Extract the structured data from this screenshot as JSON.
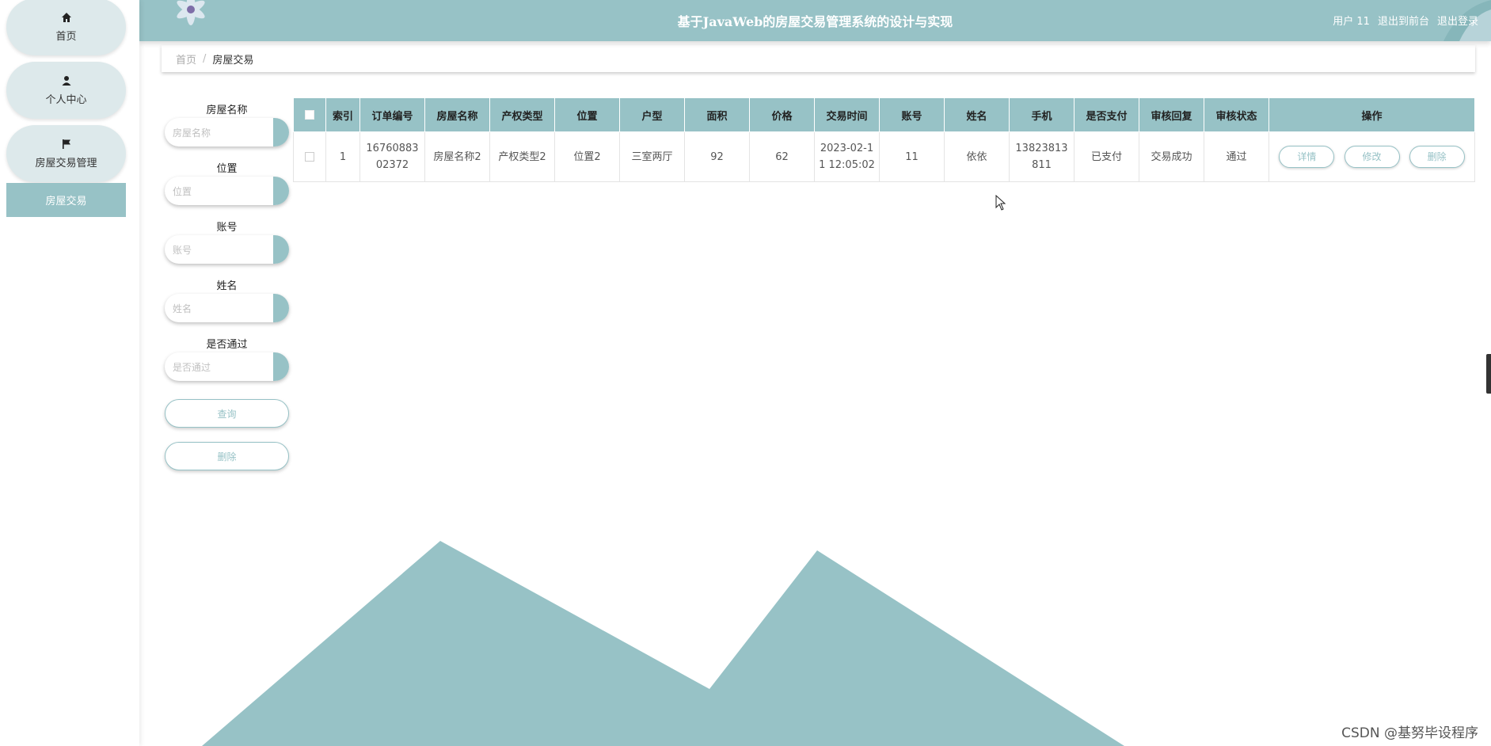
{
  "app_title": "基于JavaWeb的房屋交易管理系统的设计与实现",
  "header": {
    "user": "用户 11",
    "exit_front": "退出到前台",
    "logout": "退出登录"
  },
  "sidebar": {
    "items": [
      {
        "label": "首页",
        "icon": "home-icon"
      },
      {
        "label": "个人中心",
        "icon": "user-icon"
      },
      {
        "label": "房屋交易管理",
        "icon": "flag-icon"
      }
    ],
    "sub_item": "房屋交易"
  },
  "breadcrumb": {
    "home": "首页",
    "sep": "/",
    "current": "房屋交易"
  },
  "search": {
    "house_name": {
      "label": "房屋名称",
      "placeholder": "房屋名称"
    },
    "location": {
      "label": "位置",
      "placeholder": "位置"
    },
    "account": {
      "label": "账号",
      "placeholder": "账号"
    },
    "name": {
      "label": "姓名",
      "placeholder": "姓名"
    },
    "passed": {
      "label": "是否通过",
      "placeholder": "是否通过"
    },
    "query_button": "查询",
    "delete_button": "删除"
  },
  "table": {
    "headers": [
      "索引",
      "订单编号",
      "房屋名称",
      "产权类型",
      "位置",
      "户型",
      "面积",
      "价格",
      "交易时间",
      "账号",
      "姓名",
      "手机",
      "是否支付",
      "审核回复",
      "审核状态",
      "操作"
    ],
    "rows": [
      {
        "index": "1",
        "order_no_1": "16760883",
        "order_no_2": "02372",
        "house_name": "房屋名称2",
        "property_type": "产权类型2",
        "location": "位置2",
        "layout": "三室两厅",
        "area": "92",
        "price": "62",
        "time_1": "2023-02-1",
        "time_2": "1 12:05:02",
        "account": "11",
        "name": "依依",
        "phone_1": "13823813",
        "phone_2": "811",
        "paid": "已支付",
        "review_reply": "交易成功",
        "review_status": "通过",
        "actions": {
          "detail": "详情",
          "edit": "修改",
          "delete": "删除"
        }
      }
    ]
  },
  "watermark": "CSDN @基努毕设程序",
  "colors": {
    "accent": "#97c2c6",
    "nav_pill": "#dde9eb"
  }
}
